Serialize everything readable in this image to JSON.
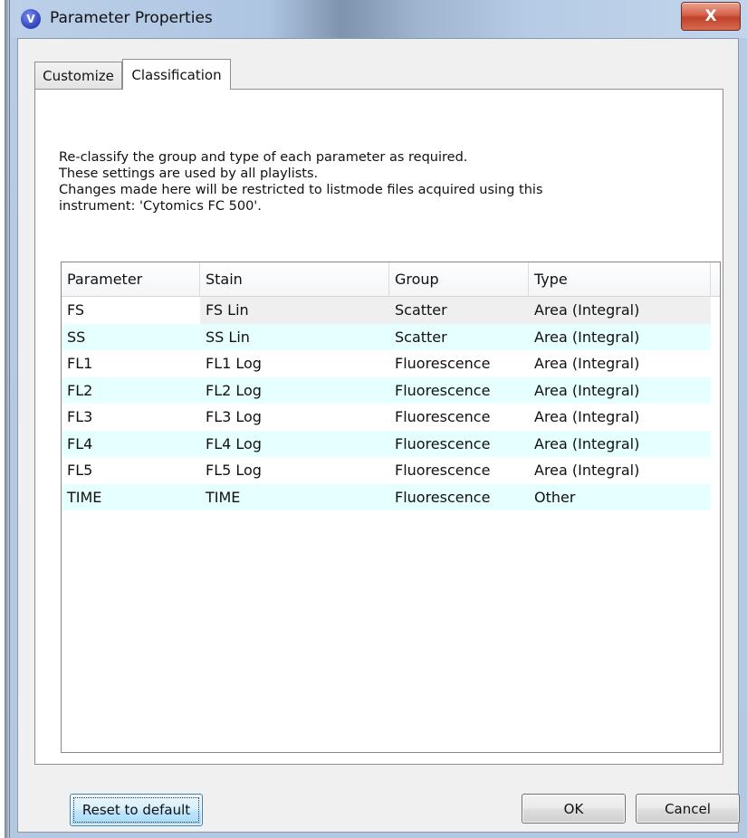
{
  "window": {
    "title": "Parameter Properties",
    "app_icon": "V",
    "close_label": "X"
  },
  "tabs": [
    {
      "label": "Customize",
      "active": false
    },
    {
      "label": "Classification",
      "active": true
    }
  ],
  "description": [
    "Re-classify the group and type of each parameter as required.",
    "These settings are used by all playlists.",
    "Changes made here will be restricted to listmode files acquired using this",
    "instrument: 'Cytomics FC 500'."
  ],
  "table": {
    "columns": [
      "Parameter",
      "Stain",
      "Group",
      "Type"
    ],
    "rows": [
      [
        "FS",
        "FS Lin",
        "Scatter",
        "Area (Integral)"
      ],
      [
        "SS",
        "SS Lin",
        "Scatter",
        "Area (Integral)"
      ],
      [
        "FL1",
        "FL1 Log",
        "Fluorescence",
        "Area (Integral)"
      ],
      [
        "FL2",
        "FL2 Log",
        "Fluorescence",
        "Area (Integral)"
      ],
      [
        "FL3",
        "FL3 Log",
        "Fluorescence",
        "Area (Integral)"
      ],
      [
        "FL4",
        "FL4 Log",
        "Fluorescence",
        "Area (Integral)"
      ],
      [
        "FL5",
        "FL5 Log",
        "Fluorescence",
        "Area (Integral)"
      ],
      [
        "TIME",
        "TIME",
        "Fluorescence",
        "Other"
      ]
    ]
  },
  "buttons": {
    "reset": "Reset to default",
    "ok": "OK",
    "cancel": "Cancel"
  },
  "colors": {
    "row_alt": "#e6ffff",
    "close_button": "#c0412a",
    "reset_button": "#bee6fd"
  }
}
